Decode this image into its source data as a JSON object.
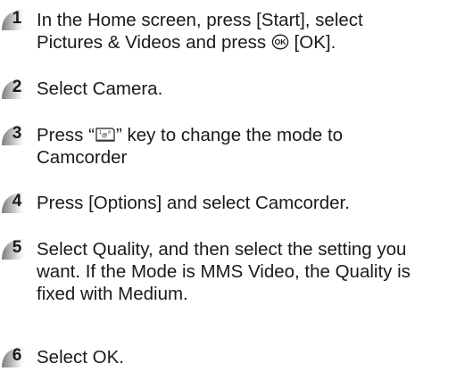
{
  "steps": [
    {
      "number": "1",
      "lines": [
        {
          "pre": "In the Home screen, press [Start], select"
        },
        {
          "pre": "Pictures & Videos and press ",
          "icon": "ok-button-icon",
          "post": " [OK]."
        }
      ]
    },
    {
      "number": "2",
      "lines": [
        {
          "pre": "Select Camera."
        }
      ]
    },
    {
      "number": "3",
      "lines": [
        {
          "pre": "Press “",
          "icon": "mode-key-icon",
          "post": "” key to change the mode to"
        },
        {
          "pre": "Camcorder"
        }
      ]
    },
    {
      "number": "4",
      "lines": [
        {
          "pre": "Press [Options] and select Camcorder."
        }
      ]
    },
    {
      "number": "5",
      "lines": [
        {
          "pre": "Select Quality, and then select the setting you"
        },
        {
          "pre": "want. If the Mode is MMS Video, the Quality is"
        },
        {
          "pre": "fixed with Medium."
        }
      ]
    },
    {
      "number": "6",
      "lines": [
        {
          "pre": "Select OK."
        }
      ]
    }
  ],
  "colors": {
    "badge_dark": "#8a8a8a",
    "badge_light": "#e6e6e6",
    "text": "#1a1a1a"
  }
}
